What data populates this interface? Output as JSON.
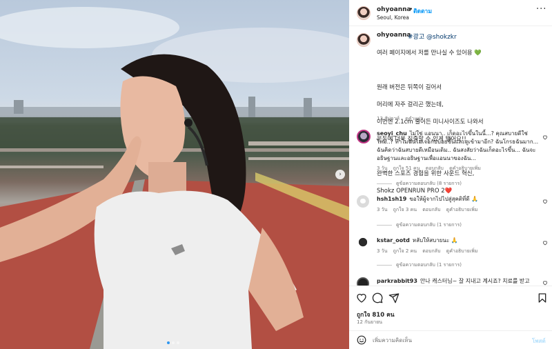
{
  "post": {
    "username": "ohyoanna",
    "follow_label": "ติดตาม",
    "location": "Seoul, Korea",
    "dot": "•",
    "more": "···"
  },
  "caption": {
    "username": "ohyoanna",
    "tags": "#광고 @shokzkr",
    "text": "여러 페이지에서 저를 만나실 수 있어용 💚\n\n원래 버전은 뒤쪽이 길어서\n머리에 자주 걸리곤 했는데,\n이번엔 2.1cm 줄어든 미니사이즈도 나와서\nrunning_placeholder",
    "lines": [
      "여러 페이지에서 저를 만나실 수 있어용 💚",
      "",
      "원래 버전은 뒤쪽이 길어서",
      "머리에 자주 걸리곤 했는데,",
      "이번엔 2.1cm 줄어든 미니사이즈도 나와서",
      "운동에 더욱 집중할 수 있게 됐어요!!",
      "",
      "완벽한 스포즈 경험을 위한 사운드 혁신,",
      "Shokz OPENRUN PRO 2❤️"
    ],
    "age": "13 สัปดาห์",
    "translate": "ดูคำแปล"
  },
  "comments": [
    {
      "username": "seoyi_chu",
      "text": "ไม่ใช่ แอนนา.. เก็ดอะไรขึ้นในนี้...? คุณสบายดีใช่ไหม..? ทำไมฉันไม่เจอกับบ่อยขึ้นและดูเข้ามาอีก? ฉันโกรธฉันมาก... ฉันคิดว่าฉันสบายดีเหมือนเดิม.. ฉันสงสัยว่าฉันเก็ดอะไรขึ้น... ฉันจะอธิษฐานและอธิษฐานเพื่อแอนนาของฉัน...",
      "age": "3 วัน",
      "likes": "ถูกใจ 51 คน",
      "reply": "ตอบกลับ",
      "translate": "ดูคำอธิบายเพิ่ม",
      "replies": "ดูข้อความตอบกลับ (8 รายการ)"
    },
    {
      "username": "hsh1sh19",
      "text": "ขอให้ผู้จากไปไปสู่สุคติที่ดี 🙏",
      "age": "3 วัน",
      "likes": "ถูกใจ 3 คน",
      "reply": "ตอบกลับ",
      "translate": "ดูคำอธิบายเพิ่ม",
      "replies": "ดูข้อความตอบกลับ (1 รายการ)"
    },
    {
      "username": "kstar_ootd",
      "text": "หลับให้สบายนะ 🙏",
      "age": "3 วัน",
      "likes": "ถูกใจ 2 คน",
      "reply": "ตอบกลับ",
      "translate": "ดูคำอธิบายเพิ่ม",
      "replies": "ดูข้อความตอบกลับ (1 รายการ)"
    },
    {
      "username": "parkrabbit93",
      "text": "안나 캐스터님~ 잘 지내고 계시죠? 치료를 받고"
    }
  ],
  "footer": {
    "likes": "ถูกใจ 810 คน",
    "date": "12 กันยายน",
    "comment_placeholder": "เพิ่มความคิดเห็น",
    "post_label": "โพสต์"
  },
  "carousel": {
    "next": "›",
    "slide_count": 3,
    "active_index": 0
  },
  "colors": {
    "accent": "#0095f6",
    "link": "#00376b",
    "muted": "#737373"
  }
}
